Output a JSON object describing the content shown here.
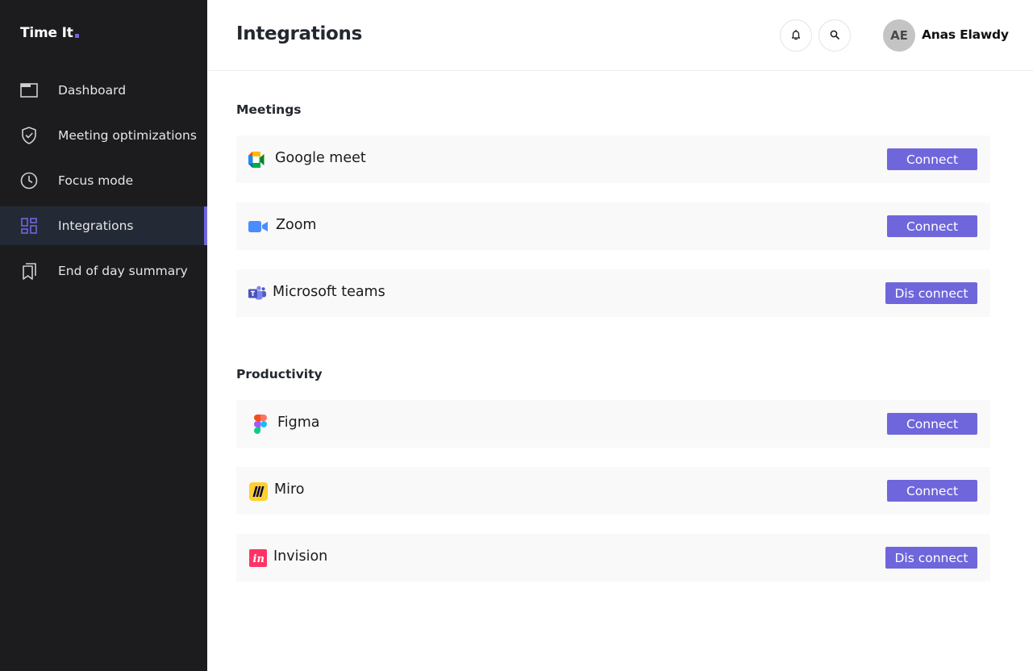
{
  "app": {
    "logo_text": "Time It",
    "accent_color": "#6f66dc"
  },
  "sidebar": {
    "items": [
      {
        "label": "Dashboard",
        "icon": "window-icon",
        "active": false
      },
      {
        "label": "Meeting optimizations",
        "icon": "shield-check-icon",
        "active": false
      },
      {
        "label": "Focus mode",
        "icon": "clock-icon",
        "active": false
      },
      {
        "label": "Integrations",
        "icon": "dashboard-grid-icon",
        "active": true
      },
      {
        "label": "End of day summary",
        "icon": "bookmarks-icon",
        "active": false
      }
    ]
  },
  "header": {
    "title": "Integrations",
    "bell_icon": "bell-icon",
    "search_icon": "search-icon",
    "user": {
      "initials": "AE",
      "name": "Anas Elawdy"
    }
  },
  "sections": [
    {
      "title": "Meetings",
      "integrations": [
        {
          "name": "Google meet",
          "icon": "google-meet-icon",
          "action": "Connect"
        },
        {
          "name": "Zoom",
          "icon": "zoom-icon",
          "action": "Connect"
        },
        {
          "name": "Microsoft teams",
          "icon": "microsoft-teams-icon",
          "action": "Dis connect"
        }
      ]
    },
    {
      "title": "Productivity",
      "integrations": [
        {
          "name": "Figma",
          "icon": "figma-icon",
          "action": "Connect"
        },
        {
          "name": "Miro",
          "icon": "miro-icon",
          "action": "Connect"
        },
        {
          "name": "Invision",
          "icon": "invision-icon",
          "action": "Dis connect"
        }
      ]
    }
  ]
}
